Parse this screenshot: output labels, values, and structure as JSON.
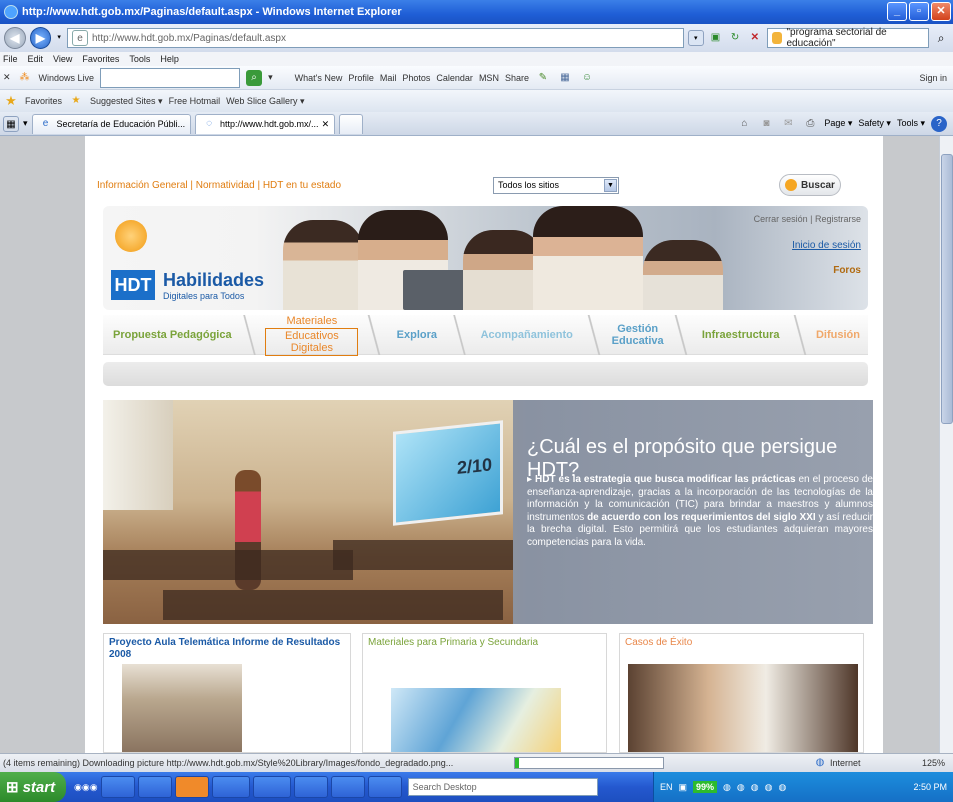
{
  "window": {
    "title": "http://www.hdt.gob.mx/Paginas/default.aspx - Windows Internet Explorer"
  },
  "address": {
    "url": "http://www.hdt.gob.mx/Paginas/default.aspx",
    "search_value": "\"programa sectorial de educación\""
  },
  "menu": [
    "File",
    "Edit",
    "View",
    "Favorites",
    "Tools",
    "Help"
  ],
  "live_toolbar": {
    "brand": "Windows Live",
    "items": [
      "What's New",
      "Profile",
      "Mail",
      "Photos",
      "Calendar",
      "MSN",
      "Share"
    ],
    "sign_in": "Sign in"
  },
  "favorites_bar": {
    "label": "Favorites",
    "items": [
      "Suggested Sites ▾",
      "Free Hotmail",
      "Web Slice Gallery ▾"
    ]
  },
  "tabs": [
    {
      "label": "Secretaría de Educación Públi..."
    },
    {
      "label": "http://www.hdt.gob.mx/..."
    }
  ],
  "command_bar": [
    "Page ▾",
    "Safety ▾",
    "Tools ▾"
  ],
  "site": {
    "topnav": "Información General | Normatividad | HDT en tu estado",
    "site_select": "Todos los sitios",
    "search_button": "Buscar",
    "logo_abbr": "HDT",
    "logo_name": "Habilidades",
    "logo_sub": "Digitales para Todos",
    "user_links": {
      "top": "Cerrar sesión | Registrarse",
      "login": "Inicio de sesión",
      "forums": "Foros"
    },
    "nav": [
      {
        "l1": "Propuesta Pedagógica",
        "l2": ""
      },
      {
        "l1": "Materiales",
        "l2": "Educativos Digitales"
      },
      {
        "l1": "Explora",
        "l2": ""
      },
      {
        "l1": "Acompañamiento",
        "l2": ""
      },
      {
        "l1": "Gestión",
        "l2": "Educativa"
      },
      {
        "l1": "Infraestructura",
        "l2": ""
      },
      {
        "l1": "Difusión",
        "l2": ""
      }
    ],
    "hero": {
      "screen_label": "2/10",
      "title": "¿Cuál es el propósito que persigue HDT?",
      "text_bold_1": "HDT es la estrategia que busca modificar las prácticas",
      "text_1": " en el proceso de enseñanza-aprendizaje, gracias a la incorporación de las tecnologías de la información y la comunicación (TIC) para brindar a maestros y alumnos instrumentos ",
      "text_bold_2": "de acuerdo con los requerimientos del siglo XXI",
      "text_2": " y así reducir la brecha digital. Esto permitirá que los estudiantes adquieran mayores competencias para la vida."
    },
    "boxes": [
      {
        "title": "Proyecto Aula Telemática Informe de Resultados 2008"
      },
      {
        "title": "Materiales para Primaria y Secundaria"
      },
      {
        "title": "Casos de Éxito"
      }
    ]
  },
  "status": {
    "text": "(4 items remaining) Downloading picture http://www.hdt.gob.mx/Style%20Library/Images/fondo_degradado.png...",
    "zone": "Internet",
    "zoom": "125%"
  },
  "taskbar": {
    "start": "start",
    "search_placeholder": "Search Desktop",
    "lang": "EN",
    "battery": "99%",
    "clock": "2:50 PM"
  },
  "colors": {
    "ie_blue": "#1f5ed6",
    "hdt_orange": "#e07d10",
    "hdt_blue": "#1b5aa6",
    "hdt_green": "#7aa33a"
  }
}
